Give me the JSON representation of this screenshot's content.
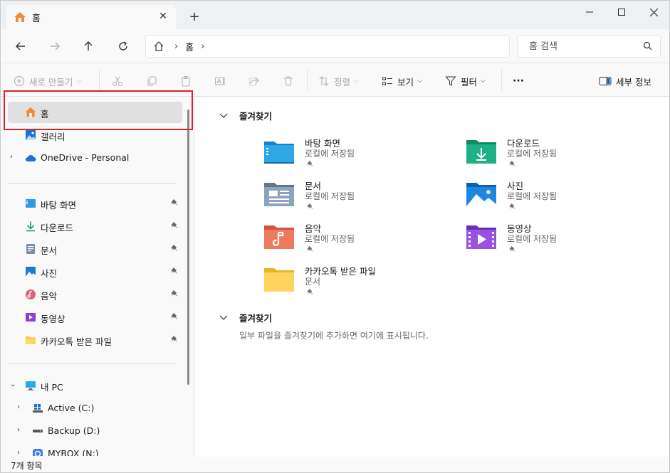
{
  "titlebar": {
    "tab_title": "홈",
    "minimize_glyph": "—",
    "maximize_glyph": "☐",
    "close_glyph": "✕"
  },
  "address": {
    "crumbs": [
      "홈"
    ],
    "search_placeholder": "홈 검색"
  },
  "toolbar": {
    "new_label": "새로 만들기",
    "sort_label": "정렬",
    "view_label": "보기",
    "filter_label": "필터",
    "more_label": "···",
    "details_label": "세부 정보"
  },
  "sidebar": {
    "top_items": [
      {
        "label": "홈",
        "icon": "home-icon"
      },
      {
        "label": "갤러리",
        "icon": "gallery-icon"
      },
      {
        "label": "OneDrive - Personal",
        "icon": "cloud-icon"
      }
    ],
    "quick_items": [
      {
        "label": "바탕 화면",
        "icon": "desktop-icon"
      },
      {
        "label": "다운로드",
        "icon": "download-icon"
      },
      {
        "label": "문서",
        "icon": "document-icon"
      },
      {
        "label": "사진",
        "icon": "pictures-icon"
      },
      {
        "label": "음악",
        "icon": "music-icon"
      },
      {
        "label": "동영상",
        "icon": "video-icon"
      },
      {
        "label": "카카오톡 받은 파일",
        "icon": "folder-icon"
      }
    ],
    "pc_items": [
      {
        "label": "내 PC",
        "icon": "pc-icon"
      },
      {
        "label": "Active (C:)",
        "icon": "drive-c-icon"
      },
      {
        "label": "Backup (D:)",
        "icon": "drive-d-icon"
      },
      {
        "label": "MYBOX (N:)",
        "icon": "mybox-icon"
      }
    ]
  },
  "main": {
    "quick_access_title": "즐겨찾기",
    "tiles": [
      {
        "name": "바탕 화면",
        "sub": "로컬에 저장됨",
        "icon": "desktop-folder-icon"
      },
      {
        "name": "다운로드",
        "sub": "로컬에 저장됨",
        "icon": "download-folder-icon"
      },
      {
        "name": "문서",
        "sub": "로컬에 저장됨",
        "icon": "documents-folder-icon"
      },
      {
        "name": "사진",
        "sub": "로컬에 저장됨",
        "icon": "pictures-folder-icon"
      },
      {
        "name": "음악",
        "sub": "로컬에 저장됨",
        "icon": "music-folder-icon"
      },
      {
        "name": "동영상",
        "sub": "로컬에 저장됨",
        "icon": "videos-folder-icon"
      },
      {
        "name": "카카오톡 받은 파일",
        "sub": "문서",
        "icon": "yellow-folder-icon"
      }
    ],
    "favorites_title": "즐겨찾기",
    "favorites_empty": "일부 파일을 즐겨찾기에 추가하면 여기에 표시됩니다."
  },
  "status": {
    "item_count": "7개 항목"
  },
  "colors": {
    "highlight": "#e0202a",
    "accent": "#0067c0",
    "selected_bg": "#e0e0e0"
  }
}
